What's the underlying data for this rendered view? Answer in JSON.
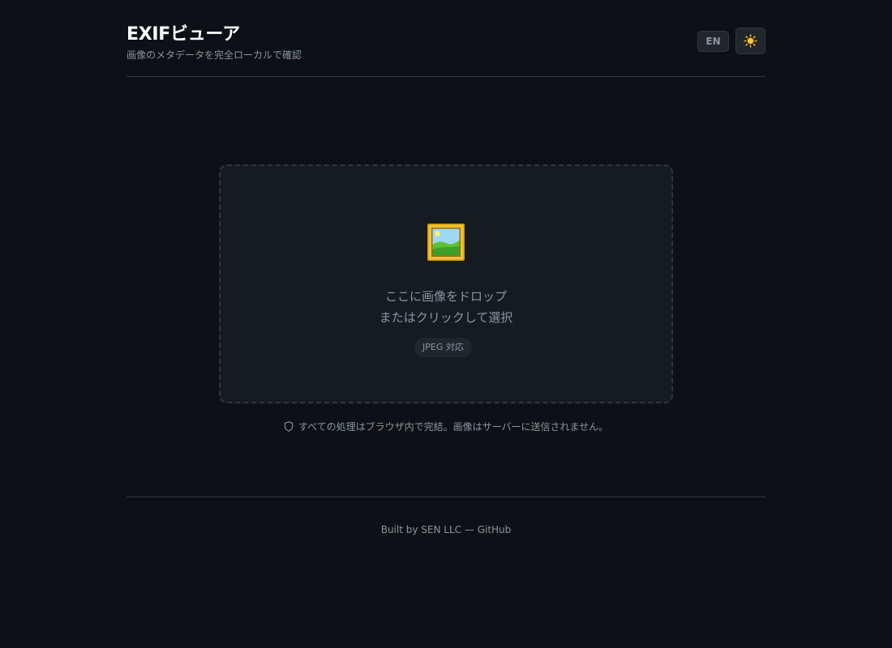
{
  "header": {
    "title": "EXIFビューア",
    "subtitle": "画像のメタデータを完全ローカルで確認",
    "language_button": "EN",
    "theme_icon": "sun-icon"
  },
  "dropzone": {
    "icon": "framed-picture-icon",
    "line1": "ここに画像をドロップ",
    "line2": "またはクリックして選択",
    "format_badge": "JPEG 対応"
  },
  "privacy": {
    "icon": "shield-icon",
    "text": "すべての処理はブラウザ内で完結。画像はサーバーに送信されません。"
  },
  "footer": {
    "built_by": "Built by SEN LLC",
    "separator": "—",
    "link": "GitHub"
  },
  "colors": {
    "background": "#0d1117",
    "surface": "#161b22",
    "border": "#30363d",
    "text_muted": "#8b949e",
    "title": "#ffffff"
  }
}
